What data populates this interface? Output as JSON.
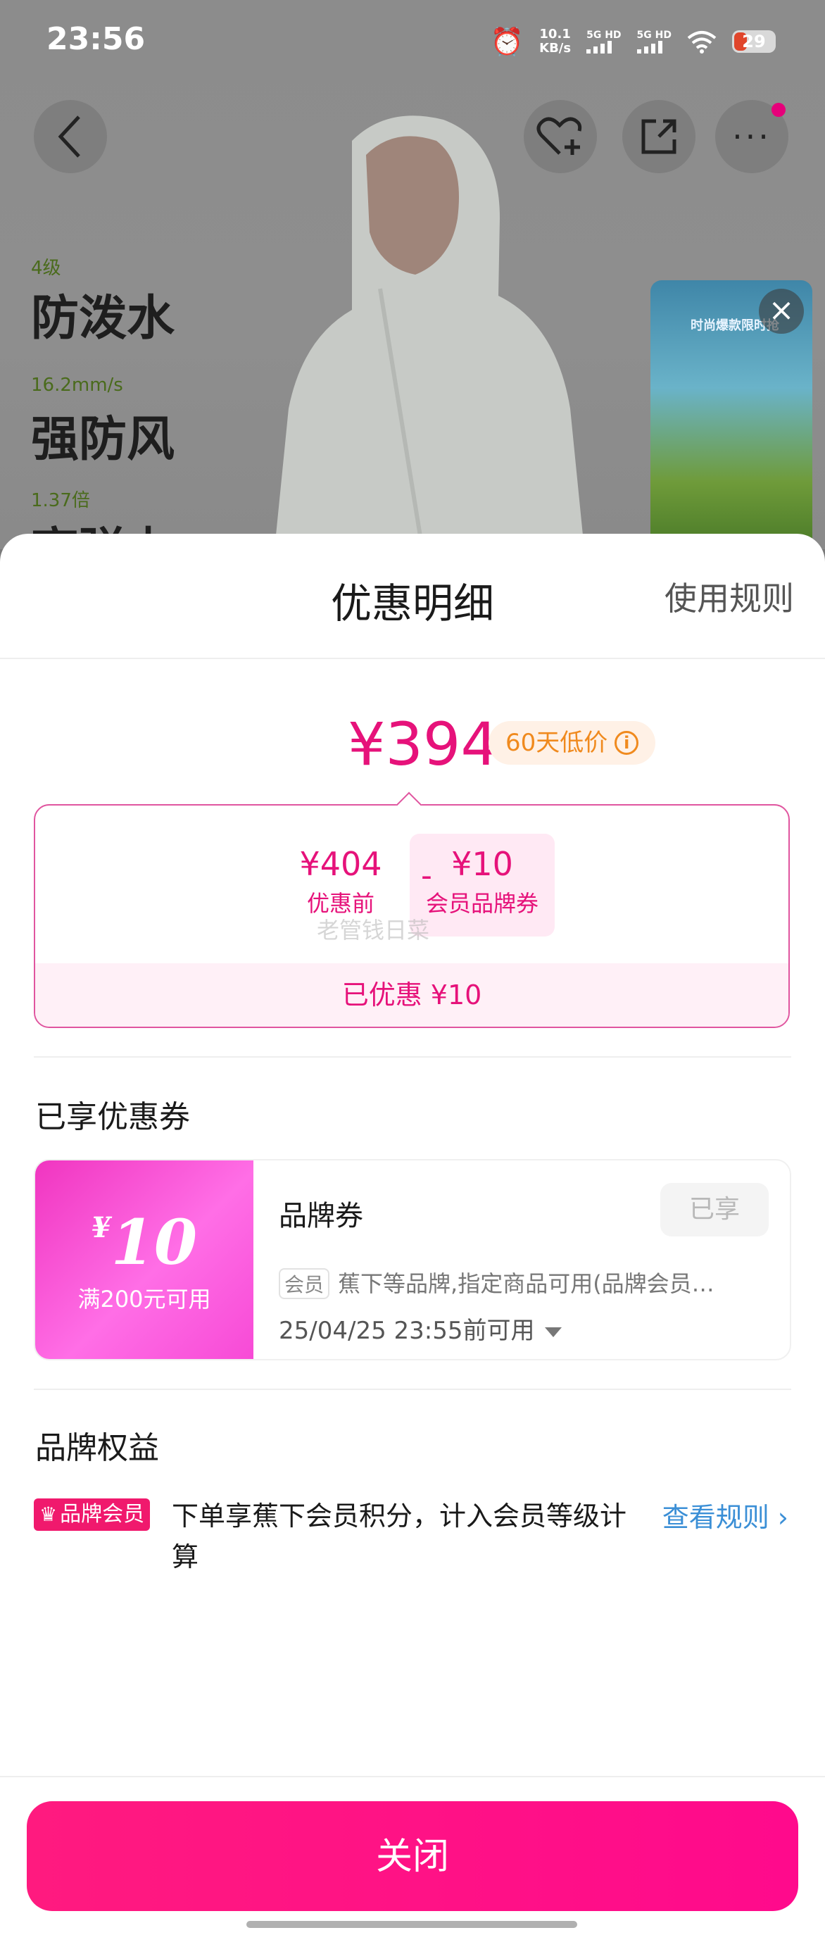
{
  "status_bar": {
    "time": "23:56",
    "net_speed_value": "10.1",
    "net_speed_unit": "KB/s",
    "sim1": "5G HD",
    "sim2": "5G HD",
    "battery": "29",
    "icons": [
      "alarm-icon",
      "wifi-icon"
    ]
  },
  "product_bg": {
    "features": [
      {
        "small": "4级",
        "big": "防泼水"
      },
      {
        "small": "16.2mm/s",
        "big": "强防风"
      },
      {
        "small": "1.37倍",
        "big": "高弹力"
      }
    ],
    "video_title": "时尚爆款限时抢"
  },
  "sheet": {
    "title": "优惠明细",
    "rules_link": "使用规则",
    "price": "¥394",
    "low_tag": "60天低价",
    "calc": {
      "original_value": "¥404",
      "original_label": "优惠前",
      "minus": "-",
      "coupon_value": "¥10",
      "coupon_label": "会员品牌券",
      "saved": "已优惠 ¥10",
      "watermark": "老管钱日菜"
    },
    "coupons_section_title": "已享优惠券",
    "coupon": {
      "yen": "¥",
      "amount": "10",
      "condition": "满200元可用",
      "name": "品牌券",
      "status": "已享",
      "tag": "会员",
      "desc": "蕉下等品牌,指定商品可用(品牌会员…",
      "expiry": "25/04/25 23:55前可用"
    },
    "benefits_section_title": "品牌权益",
    "benefit": {
      "badge": "品牌会员",
      "text": "下单享蕉下会员积分，计入会员等级计算",
      "link": "查看规则"
    },
    "close_button": "关闭"
  }
}
